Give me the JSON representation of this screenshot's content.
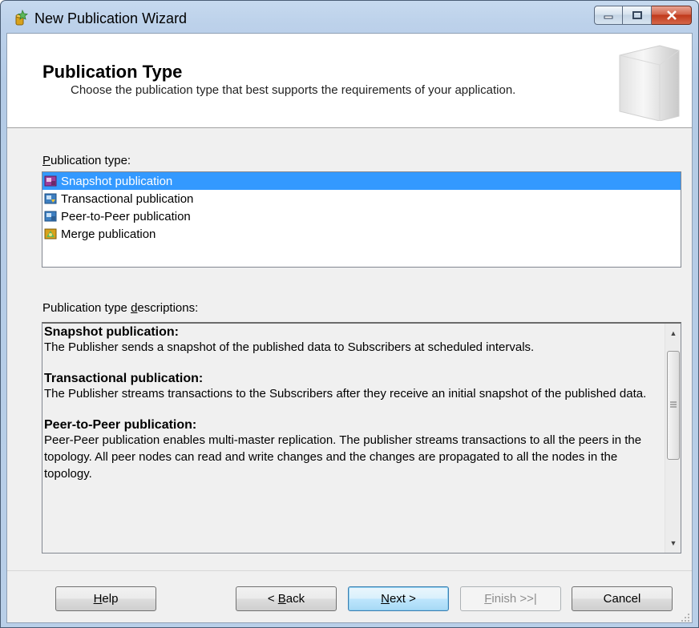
{
  "window": {
    "title": "New Publication Wizard"
  },
  "header": {
    "title": "Publication Type",
    "description": "Choose the publication type that best supports the requirements of your application."
  },
  "publication_type": {
    "label_prefix": "",
    "label_accel": "P",
    "label_rest": "ublication type:",
    "items": [
      {
        "label": "Snapshot publication",
        "icon": "snapshot-icon",
        "selected": true
      },
      {
        "label": "Transactional publication",
        "icon": "transactional-icon",
        "selected": false
      },
      {
        "label": "Peer-to-Peer publication",
        "icon": "peer-to-peer-icon",
        "selected": false
      },
      {
        "label": "Merge publication",
        "icon": "merge-icon",
        "selected": false
      }
    ]
  },
  "descriptions": {
    "label_prefix": "Publication type ",
    "label_accel": "d",
    "label_rest": "escriptions:",
    "sections": [
      {
        "title": "Snapshot publication:",
        "body": "The Publisher sends a snapshot of the published data to Subscribers at scheduled intervals."
      },
      {
        "title": "Transactional publication:",
        "body": "The Publisher streams transactions to the Subscribers after they receive an initial snapshot of the published data."
      },
      {
        "title": "Peer-to-Peer publication:",
        "body": "Peer-Peer publication enables multi-master replication. The publisher streams transactions to all the peers in the topology. All peer nodes can read and write changes and the changes are propagated to all the nodes in the topology."
      }
    ]
  },
  "buttons": {
    "help": {
      "accel": "H",
      "rest": "elp"
    },
    "back": {
      "prefix": "< ",
      "accel": "B",
      "rest": "ack"
    },
    "next": {
      "accel": "N",
      "rest": "ext >"
    },
    "finish": {
      "accel": "F",
      "rest": "inish >>|"
    },
    "cancel": {
      "label": "Cancel"
    }
  },
  "colors": {
    "selection": "#3399ff",
    "close_button": "#c0391b"
  }
}
